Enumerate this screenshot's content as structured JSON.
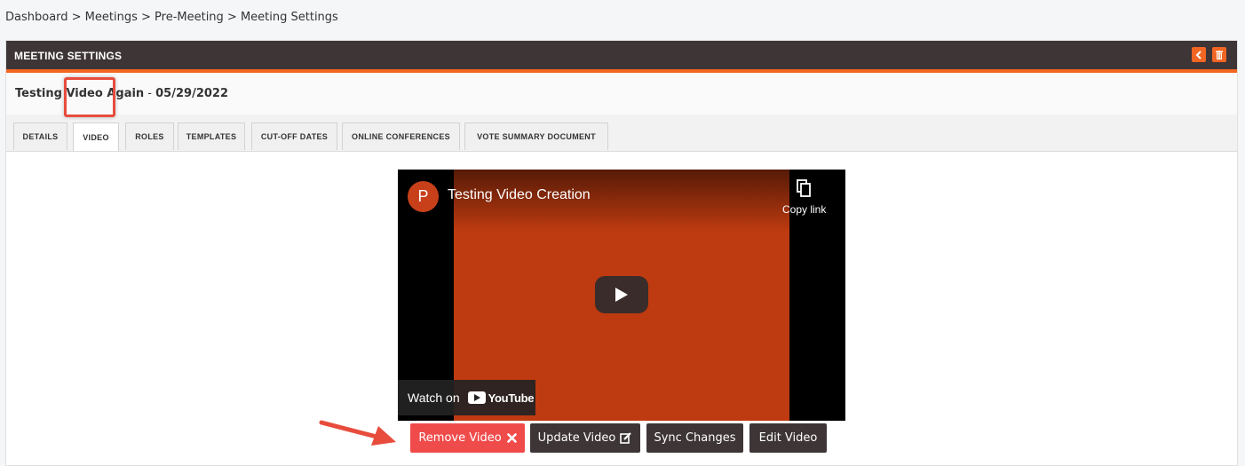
{
  "breadcrumb": {
    "text": "Dashboard > Meetings > Pre-Meeting > Meeting Settings"
  },
  "card": {
    "title": "MEETING SETTINGS",
    "header_buttons": [
      "back-chevron-icon",
      "trash-icon"
    ],
    "accent_color": "#f26522",
    "header_color": "#3d3536"
  },
  "meeting": {
    "name": "Testing Video Again",
    "separator": " - ",
    "date": "05/29/2022"
  },
  "tabs": [
    {
      "label": "DETAILS"
    },
    {
      "label": "VIDEO"
    },
    {
      "label": "ROLES"
    },
    {
      "label": "TEMPLATES"
    },
    {
      "label": "CUT-OFF DATES"
    },
    {
      "label": "ONLINE CONFERENCES"
    },
    {
      "label": "VOTE SUMMARY DOCUMENT"
    }
  ],
  "active_tab": "VIDEO",
  "video": {
    "channel_initial": "P",
    "title": "Testing Video Creation",
    "copy_link_label": "Copy link",
    "watch_on_label": "Watch on",
    "youtube_label": "YouTube",
    "frame_color": "#be3a10"
  },
  "actions": {
    "remove": "Remove Video",
    "update": "Update Video",
    "sync": "Sync Changes",
    "edit": "Edit Video"
  }
}
